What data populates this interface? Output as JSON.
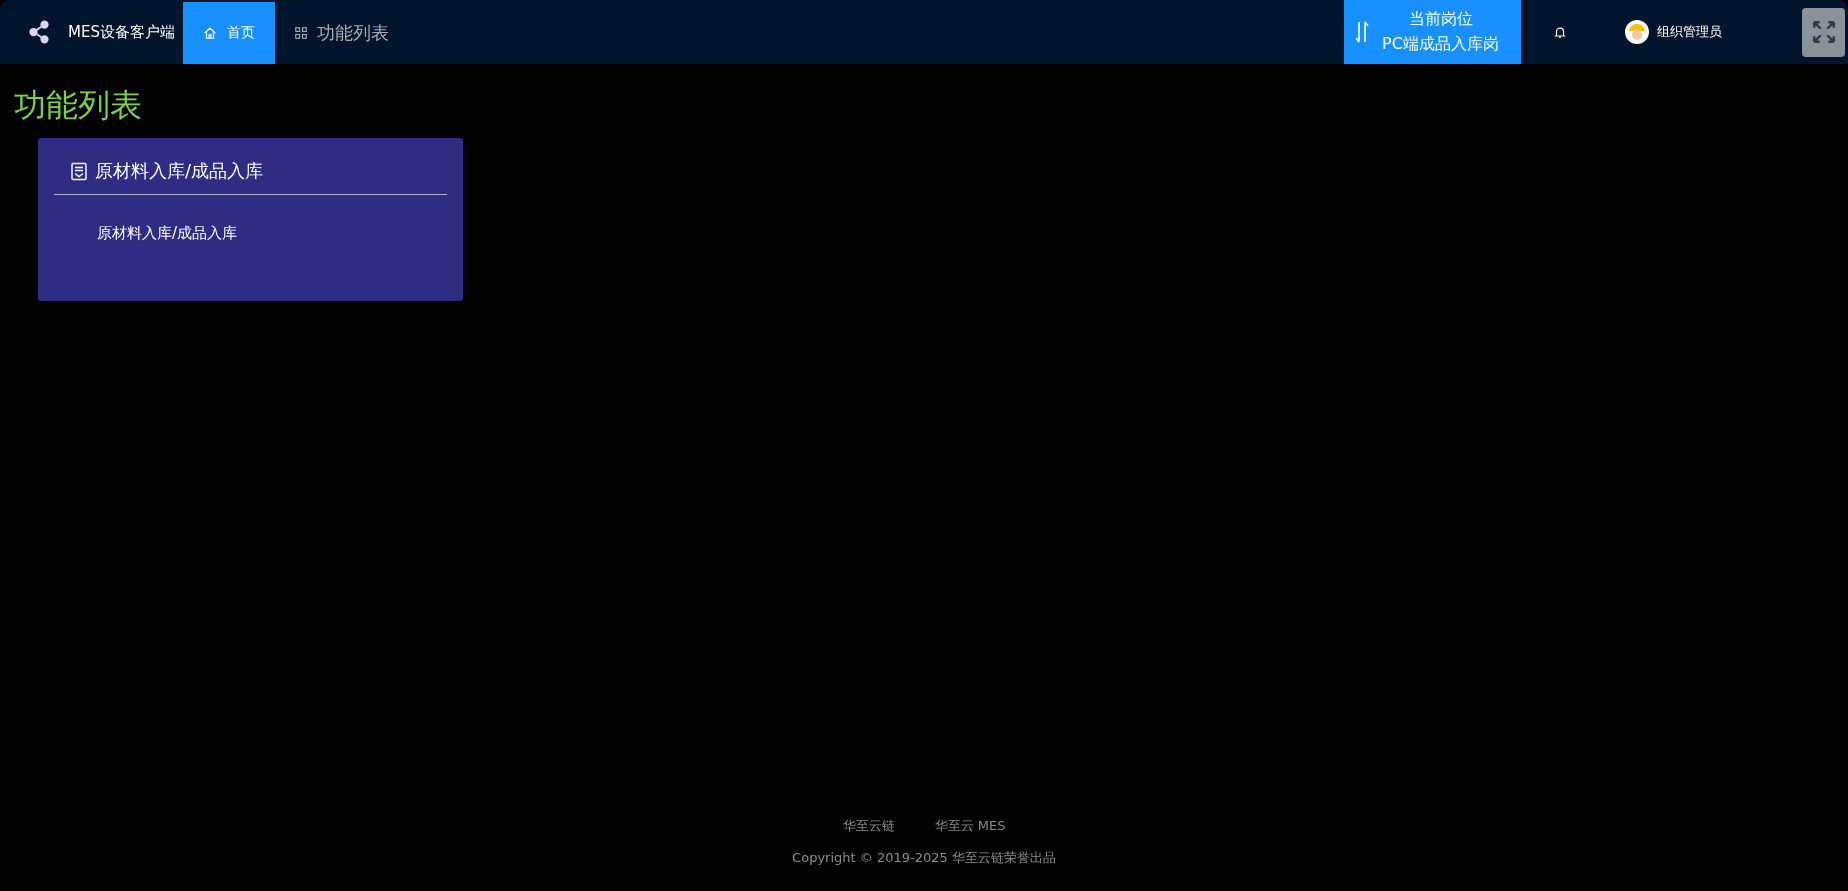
{
  "header": {
    "app_name": "MES设备客户端",
    "nav": [
      {
        "label": "首页",
        "kind": "home",
        "selected": true
      },
      {
        "label": "功能列表",
        "kind": "grid",
        "selected": false
      }
    ],
    "position": {
      "label": "当前岗位",
      "value": "PC端成品入库岗"
    },
    "user": "组织管理员"
  },
  "page_title": "功能列表",
  "groups": [
    {
      "title": "原材料入库/成品入库",
      "items": [
        "原材料入库/成品入库"
      ]
    }
  ],
  "footer": {
    "links": [
      "华至云链",
      "华至云 MES"
    ],
    "copyright": "Copyright © 2019-2025 华至云链荣誉出品"
  }
}
